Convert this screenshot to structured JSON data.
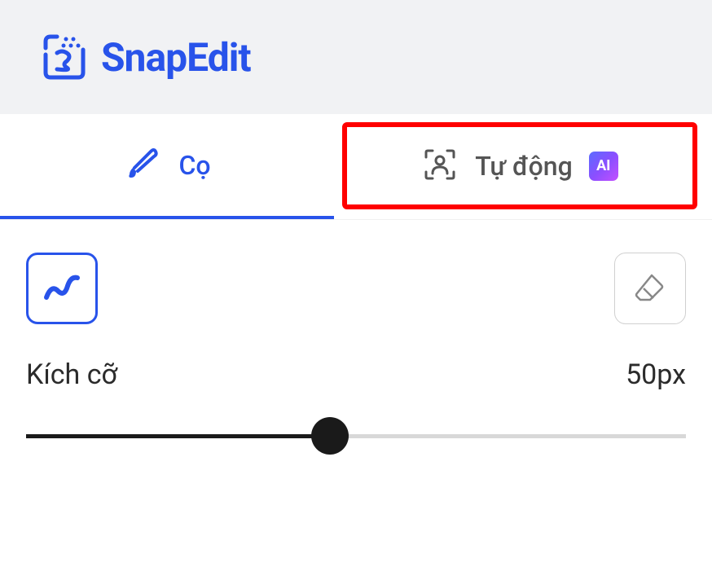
{
  "app": {
    "name": "SnapEdit",
    "colors": {
      "primary": "#2853ea",
      "highlight": "#ff0000",
      "textDark": "#2b2b2b",
      "textMuted": "#555"
    }
  },
  "tabs": {
    "brush": {
      "label": "Cọ",
      "active": true
    },
    "auto": {
      "label": "Tự động",
      "ai_badge": "AI",
      "highlighted": true
    }
  },
  "tools": {
    "draw": {
      "name": "draw",
      "selected": true
    },
    "erase": {
      "name": "erase",
      "selected": false
    }
  },
  "slider": {
    "label": "Kích cỡ",
    "value": "50px",
    "percent": 46
  }
}
